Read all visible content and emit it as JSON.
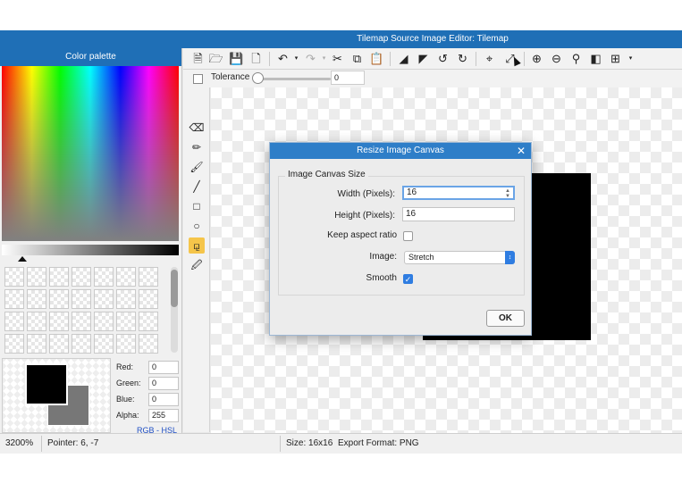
{
  "window": {
    "title": "Tilemap Source Image Editor: Tilemap"
  },
  "palette": {
    "title": "Color palette",
    "fields": [
      {
        "label": "Red:",
        "value": "0"
      },
      {
        "label": "Green:",
        "value": "0"
      },
      {
        "label": "Blue:",
        "value": "0"
      },
      {
        "label": "Alpha:",
        "value": "255"
      }
    ],
    "mode_rgb": "RGB",
    "mode_sep": " - ",
    "mode_hsl": "HSL",
    "foreground_color": "#000000",
    "background_color": "#777777"
  },
  "toolbar": {
    "icons": [
      "new-file-icon",
      "open-folder-icon",
      "save-icon",
      "export-icon",
      "undo-icon",
      "redo-icon",
      "cut-icon",
      "copy-icon",
      "paste-icon",
      "flip-horizontal-icon",
      "flip-vertical-icon",
      "rotate-left-icon",
      "rotate-right-icon",
      "crop-icon",
      "resize-canvas-icon",
      "zoom-in-icon",
      "zoom-out-icon",
      "zoom-reset-icon",
      "toggle-background-icon",
      "grid-icon"
    ],
    "tolerance_label": "Tolerance",
    "tolerance_value": "0",
    "tolerance_level": 0
  },
  "tools": {
    "items": [
      "eraser-icon",
      "pencil-icon",
      "brush-icon",
      "line-icon",
      "rectangle-icon",
      "ellipse-icon",
      "fill-bucket-icon",
      "eyedropper-icon"
    ],
    "active": "fill-bucket-icon"
  },
  "dialog": {
    "title": "Resize Image Canvas",
    "group_label": "Image Canvas Size",
    "width_label": "Width (Pixels):",
    "width_value": "16",
    "height_label": "Height (Pixels):",
    "height_value": "16",
    "keep_aspect_label": "Keep aspect ratio",
    "keep_aspect_checked": false,
    "image_label": "Image:",
    "image_value": "Stretch",
    "smooth_label": "Smooth",
    "smooth_checked": true,
    "ok_label": "OK"
  },
  "status": {
    "zoom": "3200%",
    "pointer": "Pointer: 6, -7",
    "size": "Size: 16x16",
    "export_format": "Export Format: PNG"
  },
  "colors": {
    "accent": "#1f6fb6",
    "dialog_accent": "#2e7ec8",
    "active_tool": "#f5c54a"
  }
}
